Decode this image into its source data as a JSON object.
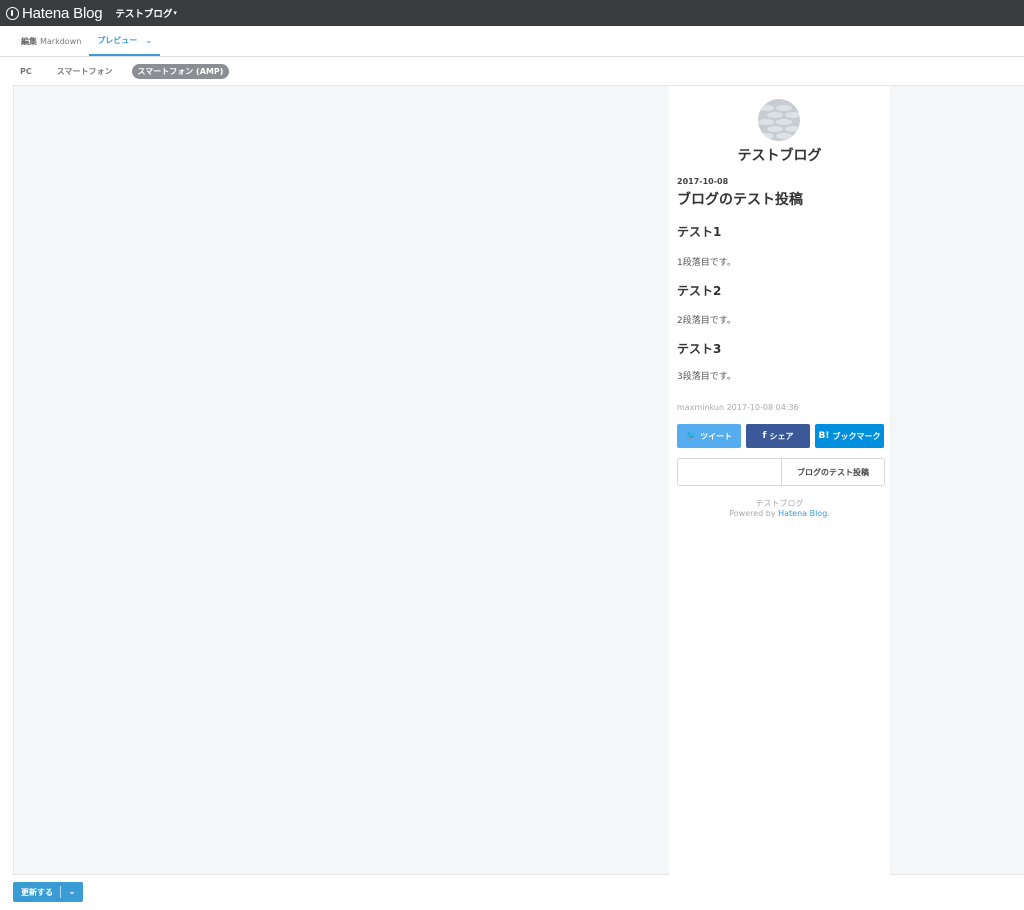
{
  "header": {
    "logo_text": "Hatena Blog",
    "blog_switch_label": "テストブログ",
    "caret": "▾"
  },
  "editor_tabs": {
    "edit_strong": "編集",
    "edit_mode": "Markdown",
    "preview_label": "プレビュー",
    "preview_chevron": "⌄"
  },
  "device_tabs": [
    "PC",
    "スマートフォン",
    "スマートフォン (AMP)"
  ],
  "preview": {
    "blog_title": "テストブログ",
    "entry_date": "2017-10-08",
    "entry_title": "ブログのテスト投稿",
    "sections": [
      {
        "heading": "テスト1",
        "text": "1段落目です。"
      },
      {
        "heading": "テスト2",
        "text": "2段落目です。"
      },
      {
        "heading": "テスト3",
        "text": "3段落目です。"
      }
    ],
    "meta": "maxminkun 2017-10-08 04:36",
    "share": {
      "tweet_icon": "🐦",
      "tweet": "ツイート",
      "facebook_icon": "f",
      "facebook": "シェア",
      "hatebu_icon": "B!",
      "hatebu": "ブックマーク"
    },
    "next_entry_title": "ブログのテスト投稿",
    "footer_blog": "テストブログ",
    "footer_powered_prefix": "Powered by ",
    "footer_powered_link": "Hatena Blog",
    "footer_powered_suffix": "."
  },
  "actions": {
    "update_label": "更新する",
    "dropdown_icon": "⌄"
  },
  "colors": {
    "header_bg": "#3a3b3d",
    "accent": "#3a9bd5",
    "twitter": "#55acee",
    "facebook": "#3b5998",
    "hatebu": "#008fde"
  }
}
